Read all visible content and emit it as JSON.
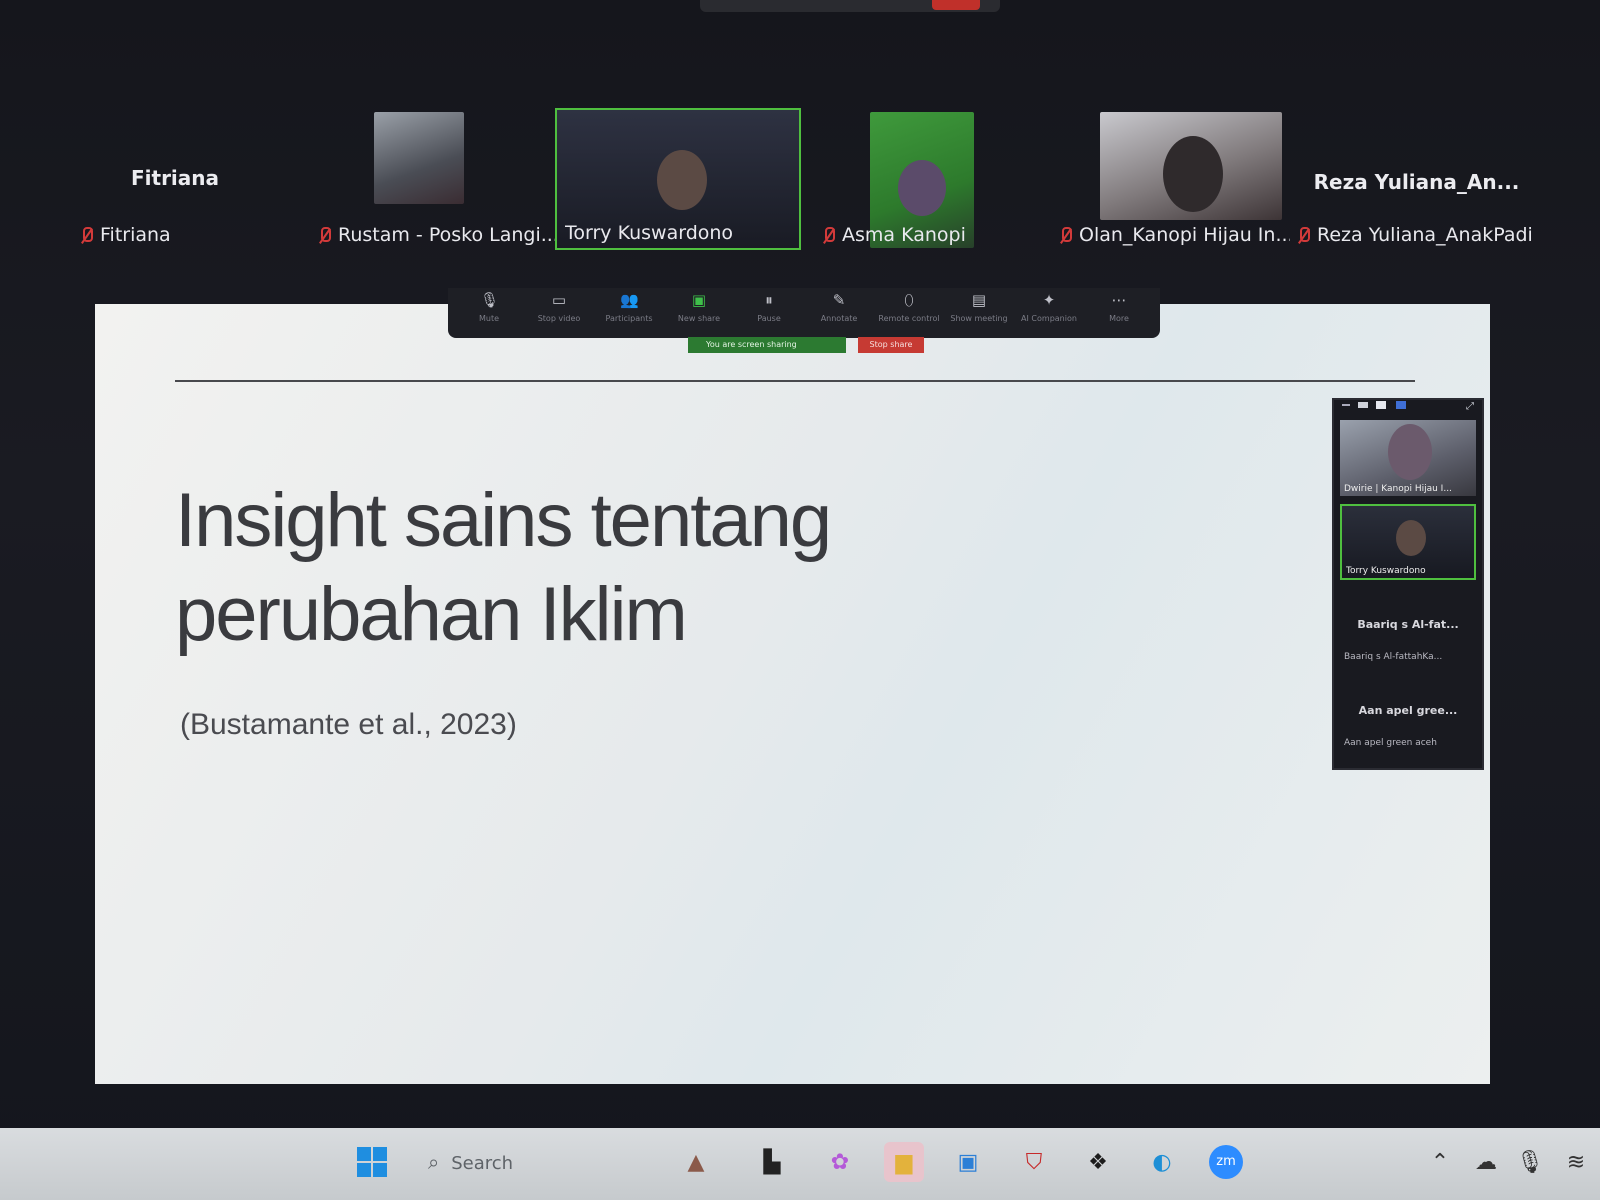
{
  "participants": [
    {
      "id": "fitriana",
      "name": "Fitriana",
      "display": "Fitriana",
      "muted": true
    },
    {
      "id": "rustam",
      "name": "Rustam - Posko Langi...",
      "muted": true
    },
    {
      "id": "torry",
      "name": "Torry Kuswardono",
      "muted": false,
      "active_speaker": true
    },
    {
      "id": "asma",
      "name": "Asma Kanopi",
      "muted": true
    },
    {
      "id": "olan",
      "name": "Olan_Kanopi Hijau In...",
      "muted": true
    },
    {
      "id": "reza",
      "name": "Reza Yuliana_AnakPadi",
      "display": "Reza  Yuliana_An...",
      "muted": true
    }
  ],
  "toolbar": {
    "items": [
      {
        "icon": "mic-icon",
        "label": "Mute"
      },
      {
        "icon": "video-icon",
        "label": "Stop video"
      },
      {
        "icon": "participants-icon",
        "label": "Participants"
      },
      {
        "icon": "share-icon",
        "label": "New share"
      },
      {
        "icon": "pause-icon",
        "label": "Pause"
      },
      {
        "icon": "pen-icon",
        "label": "Annotate"
      },
      {
        "icon": "mouse-icon",
        "label": "Remote control"
      },
      {
        "icon": "meeting-icon",
        "label": "Show meeting"
      },
      {
        "icon": "sparkle-icon",
        "label": "AI Companion"
      },
      {
        "icon": "more-icon",
        "label": "More"
      }
    ],
    "sharing_status": "You are screen sharing",
    "stop_share": "Stop share"
  },
  "slide": {
    "title_line1": "Insight sains tentang",
    "title_line2": "perubahan Iklim",
    "citation": "(Bustamante et al., 2023)"
  },
  "side_panel": {
    "tiles": [
      {
        "label": "Dwirie | Kanopi Hijau I..."
      },
      {
        "label": "Torry Kuswardono"
      }
    ],
    "audio_only": [
      {
        "name": "Baariq s Al-fat...",
        "full": "Baariq s Al-fattahKa..."
      },
      {
        "name": "Aan apel gree...",
        "full": "Aan apel green aceh"
      }
    ]
  },
  "taskbar": {
    "search_placeholder": "Search"
  },
  "colors": {
    "active_speaker": "#4fbf3f",
    "muted_red": "#d23a3a",
    "stop_red": "#c63a33",
    "share_green": "#2c7a31"
  }
}
